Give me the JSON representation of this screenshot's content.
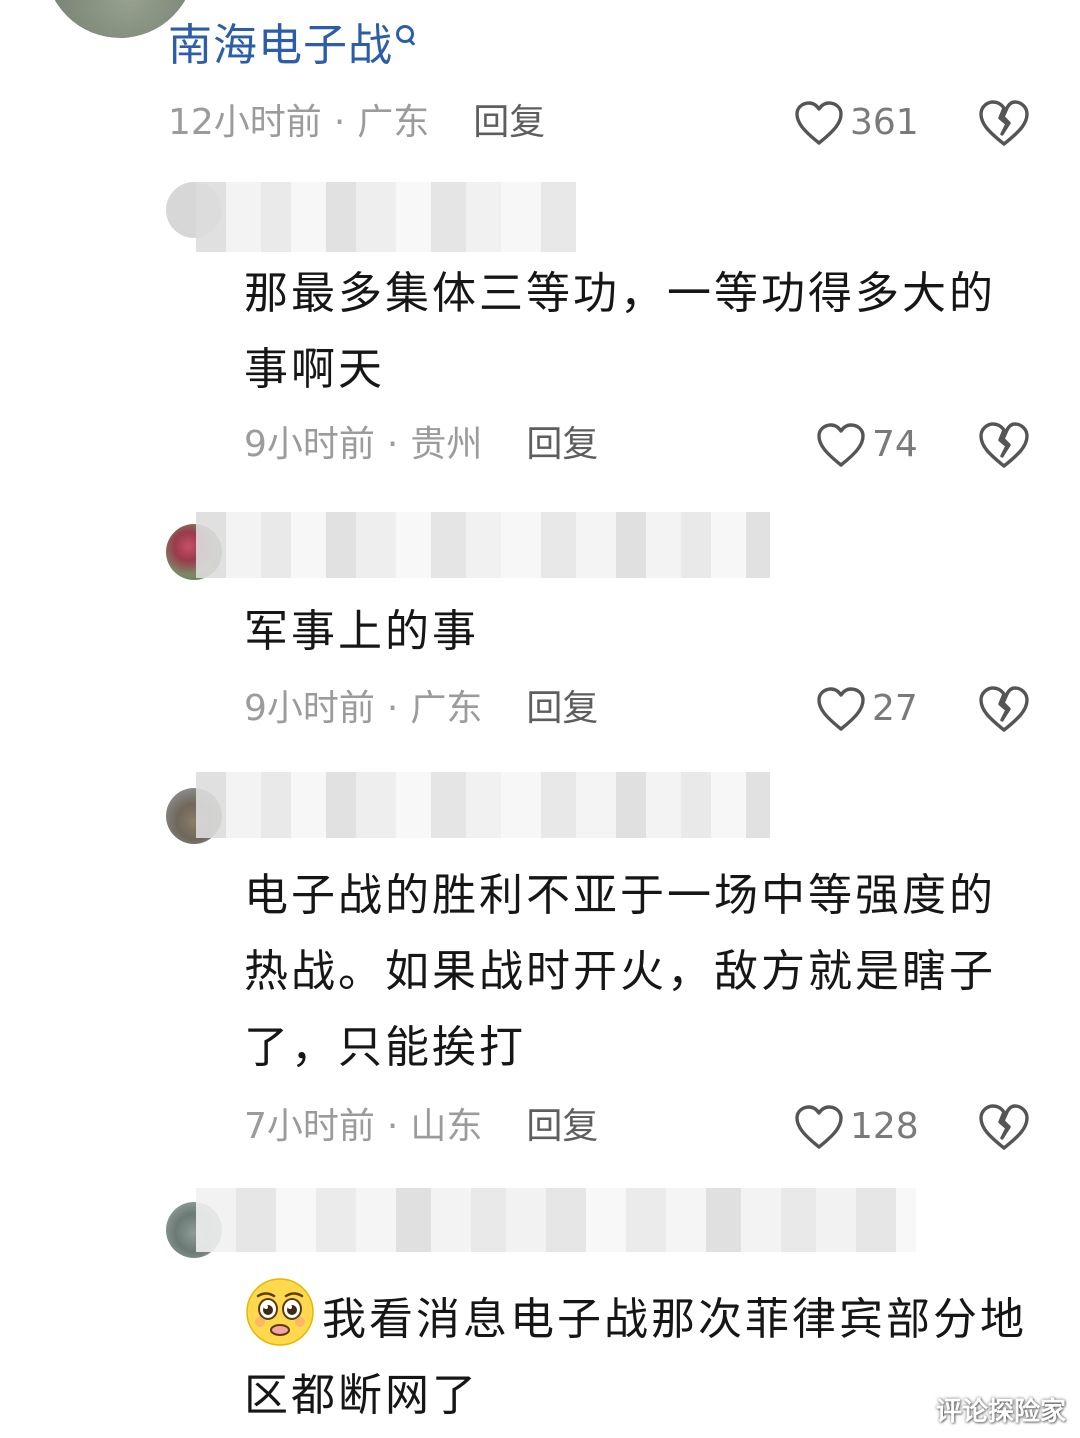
{
  "search_term": "南海电子战",
  "reply_label": "回复",
  "comments": [
    {
      "time": "12小时前",
      "location": "广东",
      "likes": "361",
      "text": "",
      "author_blurred": false
    },
    {
      "time": "9小时前",
      "location": "贵州",
      "likes": "74",
      "text": "那最多集体三等功，一等功得多大的事啊天",
      "author_blurred": true
    },
    {
      "time": "9小时前",
      "location": "广东",
      "likes": "27",
      "text": "军事上的事",
      "author_blurred": true
    },
    {
      "time": "7小时前",
      "location": "山东",
      "likes": "128",
      "text": "电子战的胜利不亚于一场中等强度的热战。如果战时开火，敌方就是瞎子了，只能挨打",
      "author_blurred": true
    },
    {
      "time": "",
      "location": "",
      "likes": "",
      "text": "我看消息电子战那次菲律宾部分地区都断网了",
      "emoji": "pleading-face",
      "author_blurred": true
    }
  ],
  "separator": "·",
  "watermark": "评论探险家",
  "colors": {
    "link_blue": "#2b5da9",
    "meta_gray": "#9b9b9b",
    "text": "#161616"
  }
}
